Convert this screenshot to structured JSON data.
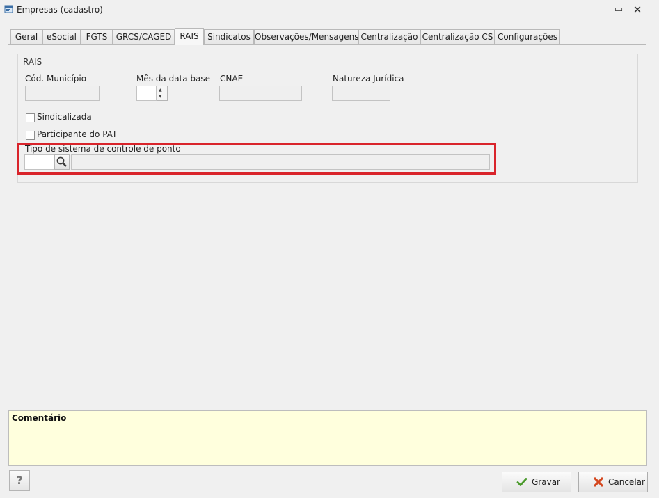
{
  "window": {
    "title": "Empresas (cadastro)",
    "restore_glyph": "▭",
    "close_glyph": "✕"
  },
  "tabs": [
    {
      "label": "Geral"
    },
    {
      "label": "eSocial"
    },
    {
      "label": "FGTS"
    },
    {
      "label": "GRCS/CAGED"
    },
    {
      "label": "RAIS"
    },
    {
      "label": "Sindicatos"
    },
    {
      "label": "Observações/Mensagens"
    },
    {
      "label": "Centralização"
    },
    {
      "label": "Centralização CS"
    },
    {
      "label": "Configurações"
    }
  ],
  "active_tab": "RAIS",
  "rais": {
    "group_title": "RAIS",
    "cod_municipio": {
      "label": "Cód. Município",
      "value": ""
    },
    "mes_data_base": {
      "label": "Mês da data base",
      "value": ""
    },
    "cnae": {
      "label": "CNAE",
      "value": ""
    },
    "natureza_juridica": {
      "label": "Natureza Jurídica",
      "value": ""
    },
    "sindicalizada": {
      "label": "Sindicalizada",
      "checked": false
    },
    "participante_pat": {
      "label": "Participante do PAT",
      "checked": false
    },
    "tipo_ponto": {
      "label": "Tipo de sistema de controle de ponto",
      "code": "",
      "description": ""
    }
  },
  "comment": {
    "label": "Comentário"
  },
  "footer": {
    "help_label": "?",
    "save_label": "Gravar",
    "cancel_label": "Cancelar"
  },
  "colors": {
    "highlight": "#d9242b",
    "comment_bg": "#ffffdd",
    "save_icon": "#4a9a2b",
    "cancel_icon": "#d4461e"
  },
  "icons": {
    "app": "app-window-icon",
    "lookup": "magnifier-icon",
    "save": "checkmark-icon",
    "cancel": "x-icon"
  }
}
